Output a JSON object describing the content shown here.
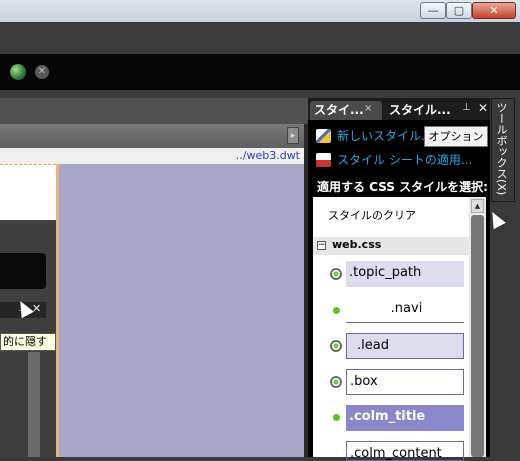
{
  "window": {
    "minimize_glyph": "—",
    "maximize_glyph": "▢",
    "close_glyph": "✕"
  },
  "toolbar": {
    "icons": [
      "web-globe-icon",
      "stop-icon"
    ]
  },
  "editor": {
    "file_path": "../web3.dwt",
    "tooltip": "的に隠す",
    "scroll_right_glyph": "▸"
  },
  "style_panel": {
    "tabs": [
      {
        "label": "スタイ...",
        "close_glyph": "×"
      },
      {
        "label": "スタイル..."
      }
    ],
    "pin_glyph": "⊥",
    "close_glyph": "✕",
    "new_style_link": "新しいスタイル...",
    "options_button": "オプション",
    "attach_link": "スタイル シートの適用...",
    "heading": "適用する CSS スタイルを選択:",
    "clear_style": "スタイルのクリア",
    "group": {
      "toggle": "−",
      "label": "web.css"
    },
    "selectors": [
      {
        "name": ".topic_path",
        "marker": "ring"
      },
      {
        "name": ".navi",
        "marker": "dot"
      },
      {
        "name": ".lead",
        "marker": "ring"
      },
      {
        "name": ".box",
        "marker": "ring"
      },
      {
        "name": ".colm_title",
        "marker": "dot",
        "selected": true
      },
      {
        "name": ".colm_content",
        "marker": "none"
      }
    ],
    "selected_color": "#8987c9",
    "link_color": "#29a7e6"
  },
  "toolbox": {
    "label": "ツールボックス(X)"
  }
}
